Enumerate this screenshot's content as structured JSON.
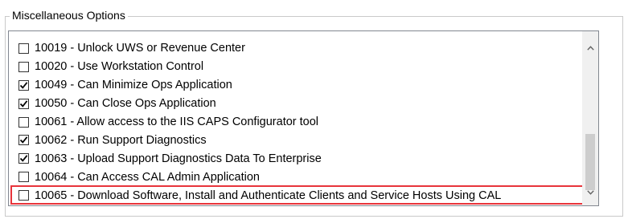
{
  "group": {
    "title": "Miscellaneous Options"
  },
  "options": [
    {
      "label": "10019 - Unlock UWS or Revenue Center",
      "checked": false
    },
    {
      "label": "10020 - Use Workstation Control",
      "checked": false
    },
    {
      "label": "10049 - Can Minimize Ops Application",
      "checked": true
    },
    {
      "label": "10050 - Can Close Ops Application",
      "checked": true
    },
    {
      "label": "10061 - Allow access to the IIS CAPS Configurator tool",
      "checked": false
    },
    {
      "label": "10062 - Run Support Diagnostics",
      "checked": true
    },
    {
      "label": "10063 - Upload Support Diagnostics Data To Enterprise",
      "checked": true
    },
    {
      "label": "10064 - Can Access CAL Admin Application",
      "checked": false
    },
    {
      "label": "10065 - Download Software, Install and Authenticate Clients and Service Hosts Using CAL",
      "checked": false,
      "highlighted": true
    }
  ],
  "colors": {
    "highlight_border": "#e8343b",
    "listbox_border": "#828790",
    "scrollbar_thumb": "#cdcdcd"
  },
  "scrollbar": {
    "position_fraction": 0.75
  }
}
